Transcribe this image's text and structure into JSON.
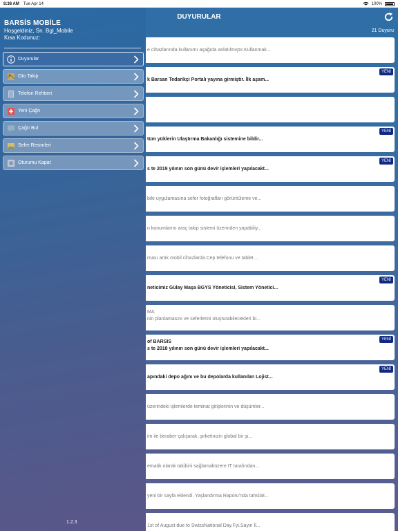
{
  "status": {
    "time": "8:38 AM",
    "date": "Tue Apr 14",
    "battery": "100%"
  },
  "navbar": {
    "title": "DUYURULAR"
  },
  "list_count": "21 Duyuru",
  "drawer": {
    "app_name": "BARSİS MOBİLE",
    "welcome": "Hoşgeldiniz, Sn. Bgl_Mobile",
    "short_code": "Kısa Kodunuz:",
    "version": "1.2.3",
    "items": [
      {
        "label": "Duyurular",
        "icon": "info-icon",
        "active": true
      },
      {
        "label": "Oto Takip",
        "icon": "map-icon",
        "active": false
      },
      {
        "label": "Telefon Rehberi",
        "icon": "phone-book-icon",
        "active": false
      },
      {
        "label": "Yeni Çağrı",
        "icon": "new-call-icon",
        "active": false
      },
      {
        "label": "Çağrı Bul",
        "icon": "find-call-icon",
        "active": false
      },
      {
        "label": "Sefer Resimleri",
        "icon": "photos-icon",
        "active": false
      },
      {
        "label": "Oturumu Kapat",
        "icon": "logout-icon",
        "active": false
      }
    ]
  },
  "badge_label": "YENİ",
  "announcements": [
    {
      "l1": "",
      "l2": "e cihazlarında kullanımı aşağıda anlatılmıştır.Kullanmak...",
      "new": false,
      "style": "gray"
    },
    {
      "l1": "",
      "l2": "k Barsan Tedarikçi Portalı yayına girmiştir. İlk aşam...",
      "new": true,
      "style": "bold"
    },
    {
      "l1": "",
      "l2": "",
      "new": false,
      "style": "gray"
    },
    {
      "l1": "",
      "l2": "tüm yüklerin Ulaştırma Bakanlığı sistemine bildir...",
      "new": true,
      "style": "bold"
    },
    {
      "l1": "",
      "l2": "s te  2019 yılının  son günü devir işlemleri yapılacakt...",
      "new": true,
      "style": "bold"
    },
    {
      "l1": "",
      "l2": "bile uygulamasına sefer fotoğrafları görüntüleme ve...",
      "new": false,
      "style": "gray"
    },
    {
      "l1": "",
      "l2": "n konumlarını araç takip sistemi üzerinden yapabiliy...",
      "new": false,
      "style": "gray"
    },
    {
      "l1": "",
      "l2": "rnası artık mobil cihazlarda.Cep telefonu ve tablet ...",
      "new": false,
      "style": "gray"
    },
    {
      "l1": "",
      "l2": "neticimiz Gülay Maşa BGYS Yöneticisi, Sistem Yönetici...",
      "new": true,
      "style": "bold"
    },
    {
      "l1": "MA",
      "l2": "nin planlamasını ve seferlerini oluşturabilecekleri bi...",
      "new": false,
      "style": "gray"
    },
    {
      "l1": "of BARSIS",
      "l2": "s te  2018 yılının  son günü devir işlemleri yapılacakt...",
      "new": true,
      "style": "bold"
    },
    {
      "l1": "",
      "l2": "apındaki depo ağını ve bu depolarda kullanılan Lojist...",
      "new": true,
      "style": "bold"
    },
    {
      "l1": "",
      "l2": "üzerindeki işlemlerde teminat girişlerinin ve düşümler...",
      "new": false,
      "style": "gray"
    },
    {
      "l1": "",
      "l2": "im ile beraber çalışarak, şirketinizin global bir şi...",
      "new": false,
      "style": "gray"
    },
    {
      "l1": "",
      "l2": "ematik olarak takibini sağlamaküzere  IT tarafından...",
      "new": false,
      "style": "gray"
    },
    {
      "l1": "",
      "l2": "yeni bir sayfa eklendi. Yaşlandırma Raporu'nda tahsilat...",
      "new": false,
      "style": "gray"
    },
    {
      "l1": "",
      "l2": "1st of August due to SwissNational Day.Fyi.Sayin İl...",
      "new": false,
      "style": "gray"
    }
  ]
}
